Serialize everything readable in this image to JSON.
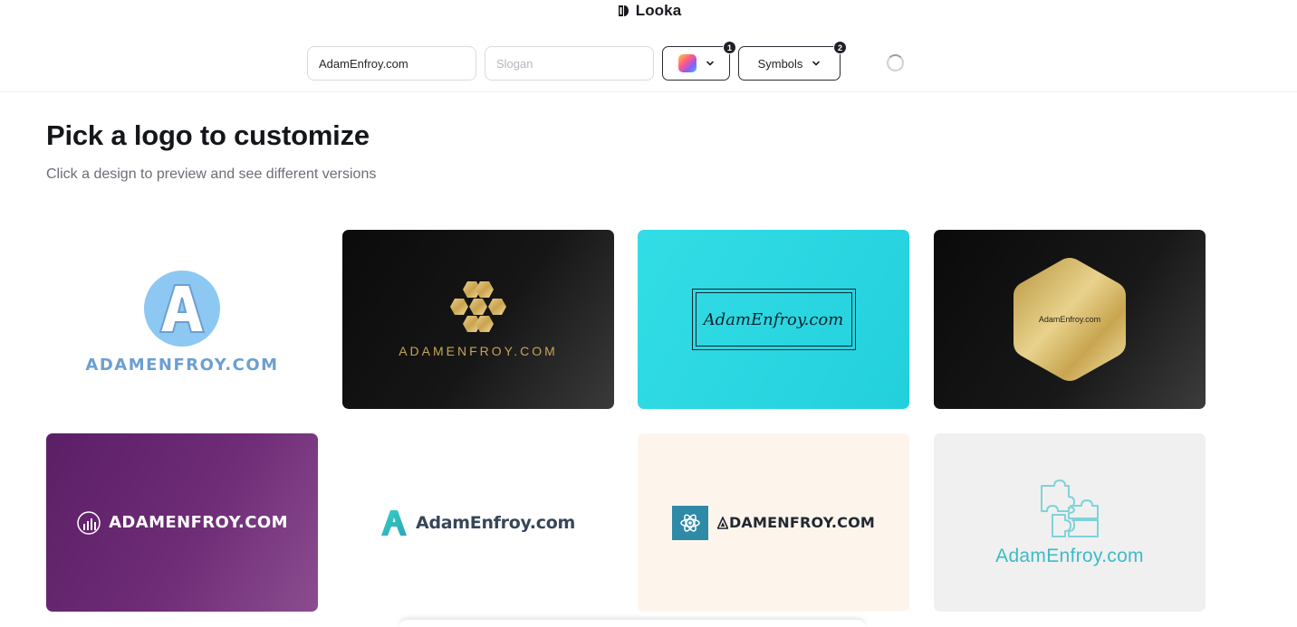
{
  "brand": {
    "name": "Looka",
    "icon": "looka-logo-icon"
  },
  "toolbar": {
    "company_name_value": "AdamEnfroy.com",
    "slogan_placeholder": "Slogan",
    "colors_badge": "1",
    "symbols_label": "Symbols",
    "symbols_badge": "2"
  },
  "page": {
    "title": "Pick a logo to customize",
    "subtitle": "Click a design to preview and see different versions"
  },
  "logos": [
    {
      "text": "ADAMENFROY.COM",
      "background": "#ffffff",
      "text_color": "#6c9fd1",
      "symbol": "letter-a-circle-icon",
      "symbol_text": "A"
    },
    {
      "text": "ADAMENFROY.COM",
      "background": "#111111",
      "text_color": "#c6a458",
      "symbol": "hexagon-cluster-icon"
    },
    {
      "text": "AdamEnfroy.com",
      "background": "#2ad6e0",
      "text_color": "#14222b",
      "symbol": "double-frame"
    },
    {
      "text": "AdamEnfroy.com",
      "background": "#111111",
      "text_color": "#2a2417",
      "symbol": "gold-hexagon-icon"
    },
    {
      "text": "ADAMENFROY.COM",
      "background": "#6a2873",
      "text_color": "#ffffff",
      "symbol": "chart-circle-icon"
    },
    {
      "text": "AdamEnfroy.com",
      "background": "#ffffff",
      "text_color": "#37465a",
      "symbol": "letter-a-icon"
    },
    {
      "text": "DAMENFROY.COM",
      "background": "#fdf5ec",
      "text_color": "#222831",
      "symbol": "atom-box-icon"
    },
    {
      "text": "AdamEnfroy.com",
      "background": "#f0f0f1",
      "text_color": "#3cbcc4",
      "symbol": "puzzle-icon"
    }
  ]
}
